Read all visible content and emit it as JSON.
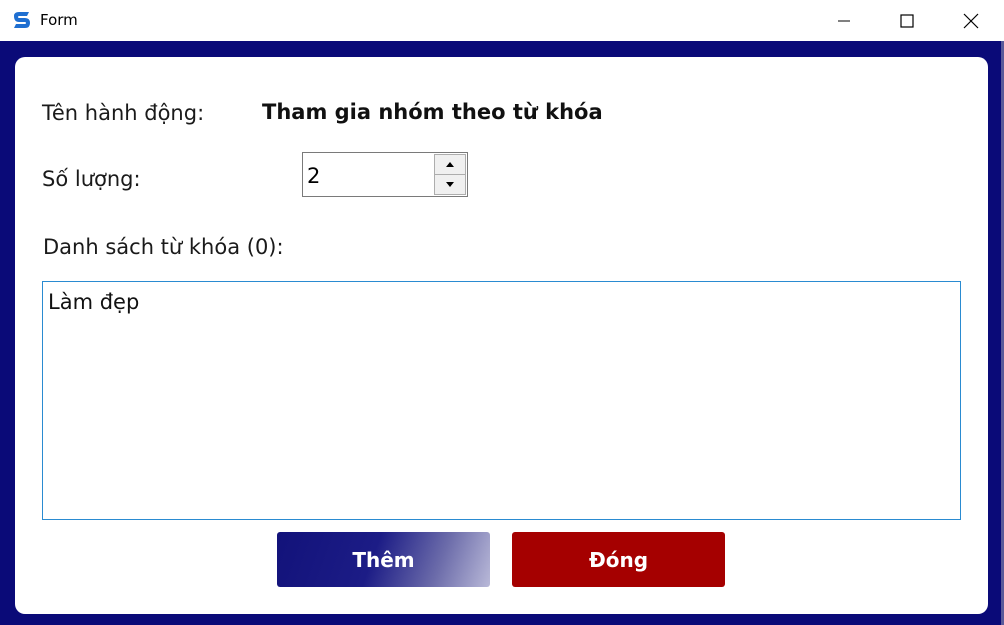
{
  "window": {
    "title": "Form",
    "icon": "app-logo-icon"
  },
  "controls": {
    "minimize_icon": "minimize-icon",
    "maximize_icon": "maximize-icon",
    "close_icon": "close-icon"
  },
  "form": {
    "action_label": "Tên hành động:",
    "action_value": "Tham gia nhóm theo từ khóa",
    "quantity_label": "Số lượng:",
    "quantity_value": "2",
    "keyword_list_label": "Danh sách từ khóa (0):",
    "keyword_list_value": "Làm đẹp"
  },
  "buttons": {
    "add_label": "Thêm",
    "close_label": "Đóng"
  },
  "colors": {
    "frame": "#0a0a78",
    "add_button": "#12127a",
    "close_button": "#a50000",
    "textarea_border": "#2a8bd1"
  }
}
